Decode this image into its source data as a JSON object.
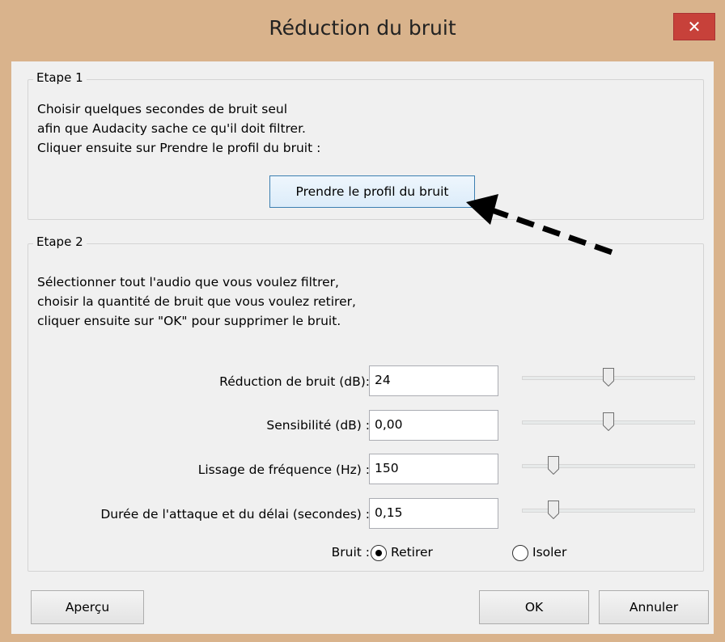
{
  "window": {
    "title": "Réduction du bruit",
    "close_label": "✕"
  },
  "step1": {
    "legend": "Etape 1",
    "lines": [
      "Choisir quelques secondes de bruit seul",
      "afin que Audacity sache ce qu'il doit filtrer.",
      "Cliquer ensuite sur Prendre le profil du bruit :"
    ],
    "profile_button": "Prendre le profil du bruit"
  },
  "step2": {
    "legend": "Etape 2",
    "lines": [
      "Sélectionner tout l'audio que vous voulez filtrer,",
      "choisir la quantité de bruit que vous voulez retirer,",
      "cliquer ensuite sur \"OK\" pour supprimer le bruit."
    ],
    "params": [
      {
        "label": "Réduction de bruit (dB):",
        "value": "24",
        "slider_fraction": 0.5
      },
      {
        "label": "Sensibilité (dB) :",
        "value": "0,00",
        "slider_fraction": 0.5
      },
      {
        "label": "Lissage de fréquence (Hz) :",
        "value": "150",
        "slider_fraction": 0.18
      },
      {
        "label": "Durée de l'attaque et du délai (secondes) :",
        "value": "0,15",
        "slider_fraction": 0.18
      }
    ],
    "noise": {
      "label": "Bruit :",
      "options": [
        {
          "label": "Retirer",
          "selected": true
        },
        {
          "label": "Isoler",
          "selected": false
        }
      ]
    }
  },
  "footer": {
    "preview_button": "Aperçu",
    "ok_button": "OK",
    "cancel_button": "Annuler"
  },
  "annotation": {
    "arrow_icon": "dashed-arrow-icon",
    "color": "#000000"
  }
}
